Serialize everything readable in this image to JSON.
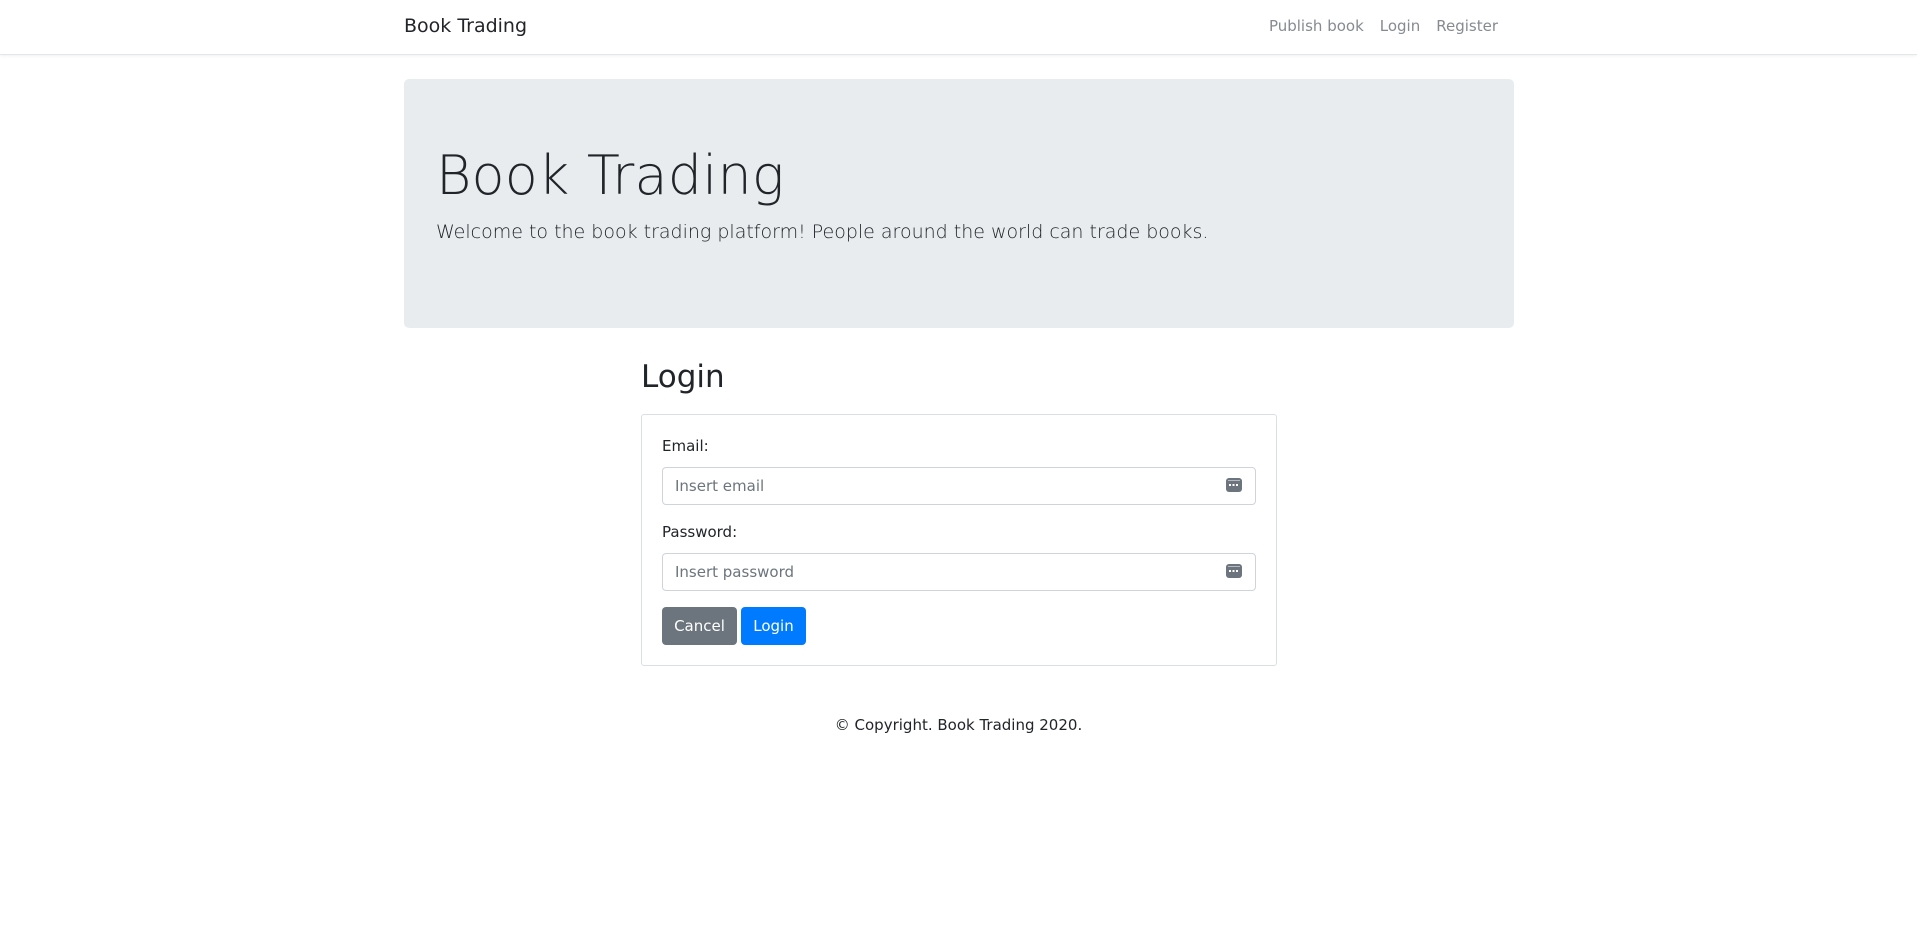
{
  "navbar": {
    "brand": "Book Trading",
    "links": [
      {
        "label": "Publish book"
      },
      {
        "label": "Login"
      },
      {
        "label": "Register"
      }
    ]
  },
  "jumbotron": {
    "title": "Book Trading",
    "lead": "Welcome to the book trading platform! People around the world can trade books."
  },
  "login": {
    "heading": "Login",
    "email_label": "Email:",
    "email_placeholder": "Insert email",
    "email_value": "",
    "password_label": "Password:",
    "password_placeholder": "Insert password",
    "password_value": "",
    "cancel_label": "Cancel",
    "submit_label": "Login",
    "field_icon": "password-manager-icon"
  },
  "footer": {
    "text": "© Copyright. Book Trading 2020."
  },
  "colors": {
    "primary": "#007bff",
    "secondary": "#6c757d",
    "jumbotron_bg": "#e9ecef",
    "nav_link": "#858b91"
  }
}
